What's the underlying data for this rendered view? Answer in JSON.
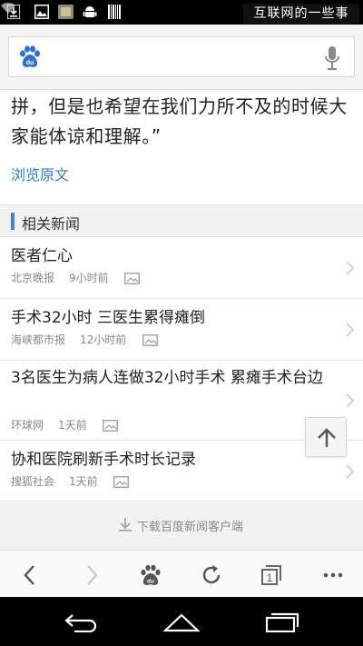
{
  "status_bar": {
    "icons": [
      "download-icon",
      "gallery-icon",
      "app-icon",
      "android-icon",
      "barcode-icon",
      "wifi-icon"
    ],
    "watermark": "互联网的一些事"
  },
  "search": {
    "logo": "baidu-paw-icon",
    "placeholder": "",
    "mic": "microphone-icon"
  },
  "article": {
    "text": "拼，但是也希望在我们力所不及的时候大家能体谅和理解。”",
    "read_original": "浏览原文"
  },
  "related": {
    "title": "相关新闻",
    "items": [
      {
        "title": "医者仁心",
        "source": "北京晚报",
        "time": "9小时前"
      },
      {
        "title": "手术32小时 三医生累得瘫倒",
        "source": "海峡都市报",
        "time": "12小时前"
      },
      {
        "title": "3名医生为病人连做32小时手术 累瘫手术台边",
        "source": "环球网",
        "time": "1天前"
      },
      {
        "title": "协和医院刷新手术时长记录",
        "source": "搜狐社会",
        "time": "1天前"
      }
    ]
  },
  "download_client": "下载百度新闻客户端",
  "toolbar": {
    "buttons": [
      "back-icon",
      "forward-icon",
      "baidu-home-icon",
      "refresh-icon",
      "tabs-icon",
      "more-icon"
    ],
    "tab_count": "1"
  },
  "colors": {
    "accent": "#3b86e0",
    "link": "#2d7fd8",
    "text": "#222222",
    "meta": "#888888"
  }
}
